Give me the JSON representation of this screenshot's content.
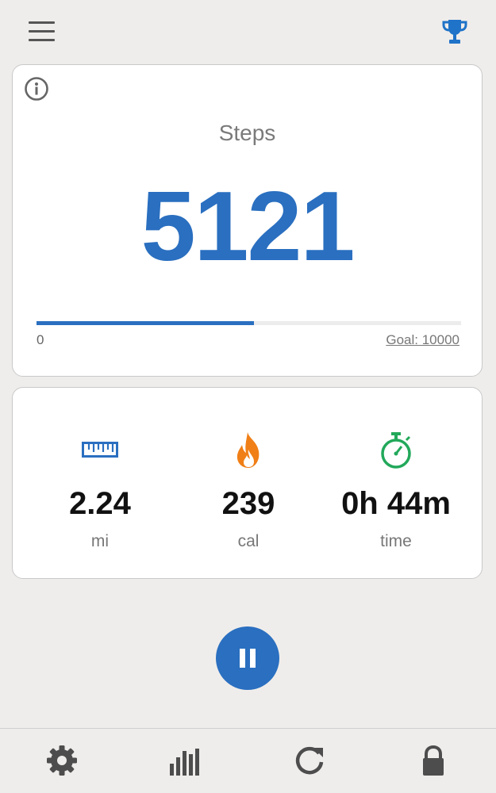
{
  "header": {
    "menu_icon": "menu-icon",
    "trophy_icon": "trophy-icon",
    "accent_color": "#1f73c8"
  },
  "steps_card": {
    "info_icon": "info-icon",
    "label": "Steps",
    "value": "5121",
    "progress_fraction": 0.5121,
    "progress_min": "0",
    "goal_label": "Goal: 10000",
    "value_color": "#2a6fc0"
  },
  "stats": [
    {
      "icon": "ruler-icon",
      "value": "2.24",
      "unit": "mi",
      "color": "#2a6fc0"
    },
    {
      "icon": "flame-icon",
      "value": "239",
      "unit": "cal",
      "color": "#f07f17"
    },
    {
      "icon": "stopwatch-icon",
      "value": "0h 44m",
      "unit": "time",
      "color": "#22a85a"
    }
  ],
  "controls": {
    "pause_icon": "pause-icon",
    "pause_color": "#2a6fc0"
  },
  "bottom_nav": [
    {
      "icon": "settings-icon"
    },
    {
      "icon": "bar-chart-icon"
    },
    {
      "icon": "refresh-icon"
    },
    {
      "icon": "lock-icon"
    }
  ]
}
